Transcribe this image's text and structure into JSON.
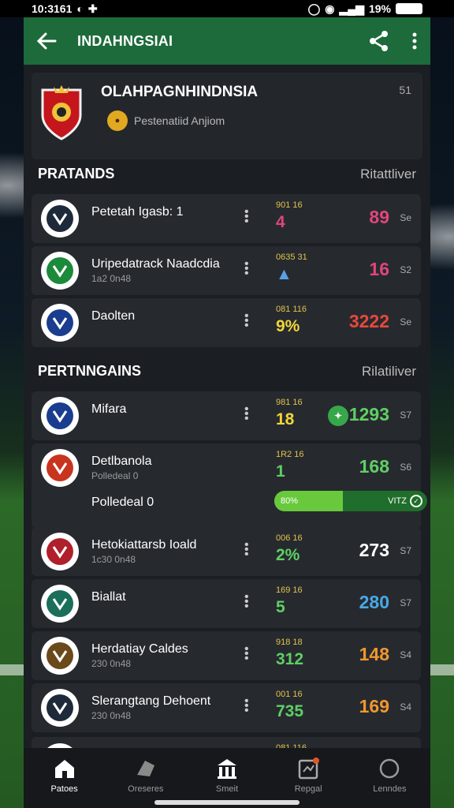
{
  "status": {
    "time": "10:3161",
    "battery": "19%"
  },
  "appbar": {
    "title": "INDAHNGSIAI"
  },
  "league": {
    "name": "OLAHPAGNHINDNSIA",
    "subtitle": "Pestenatiid Anjiom",
    "more": "51"
  },
  "section1": {
    "title": "PRATANDS",
    "right": "Ritattliver"
  },
  "section2": {
    "title": "PERTNNGAINS",
    "right": "Rilatiliver"
  },
  "rows1": [
    {
      "name": "Petetah Igasb: 1",
      "sub": "",
      "small": "901 16",
      "value": "4",
      "value_color": "#e0467a",
      "score": "89",
      "score_color": "#e0467a",
      "unit": "Se"
    },
    {
      "name": "Uripedatrack Naadcdia",
      "sub": "1a2 0n48",
      "small": "0635 31",
      "value": "▲",
      "value_color": "#5aa0e8",
      "score": "16",
      "score_color": "#e0467a",
      "unit": "S2"
    },
    {
      "name": "Daolten",
      "sub": "",
      "small": "081 116",
      "value": "9%",
      "value_color": "#f0d63a",
      "score": "3222",
      "score_color": "#e8483a",
      "unit": "Se"
    }
  ],
  "rows2": [
    {
      "name": "Mifara",
      "sub": "",
      "small": "981 16",
      "value": "18",
      "value_color": "#f0d63a",
      "score": "1293",
      "score_color": "#5fcf64",
      "unit": "S7",
      "badge": "✦"
    },
    {
      "name": "Detlbanola",
      "sub": "Polledeal 0",
      "small": "1R2 16",
      "value": "1",
      "value_color": "#5fcf64",
      "score": "168",
      "score_color": "#5fcf64",
      "unit": "S6",
      "bar_left": "80%",
      "bar_right": "VITZ",
      "bar_progress": 0.45
    },
    {
      "name": "Hetokiattarsb Ioald",
      "sub": "1c30 0n48",
      "small": "006 16",
      "value": "2%",
      "value_color": "#5fcf64",
      "score": "273",
      "score_color": "#ffffff",
      "unit": "S7"
    },
    {
      "name": "Biallat",
      "sub": "",
      "small": "169 16",
      "value": "5",
      "value_color": "#5fcf64",
      "score": "280",
      "score_color": "#49a9e6",
      "unit": "S7"
    },
    {
      "name": "Herdatiay Caldes",
      "sub": "230 0n48",
      "small": "918 18",
      "value": "312",
      "value_color": "#5fcf64",
      "score": "148",
      "score_color": "#f0962e",
      "unit": "S4"
    },
    {
      "name": "Slerangtang Dehoent",
      "sub": "230 0n48",
      "small": "001 16",
      "value": "735",
      "value_color": "#5fcf64",
      "score": "169",
      "score_color": "#f0962e",
      "unit": "S4"
    }
  ],
  "partial_small": "081 116",
  "nav": [
    {
      "label": "Patoes",
      "icon": "home-icon"
    },
    {
      "label": "Oreseres",
      "icon": "ball-icon"
    },
    {
      "label": "Smeit",
      "icon": "stadium-icon"
    },
    {
      "label": "Repgal",
      "icon": "report-icon"
    },
    {
      "label": "Lenndes",
      "icon": "profile-icon"
    }
  ]
}
